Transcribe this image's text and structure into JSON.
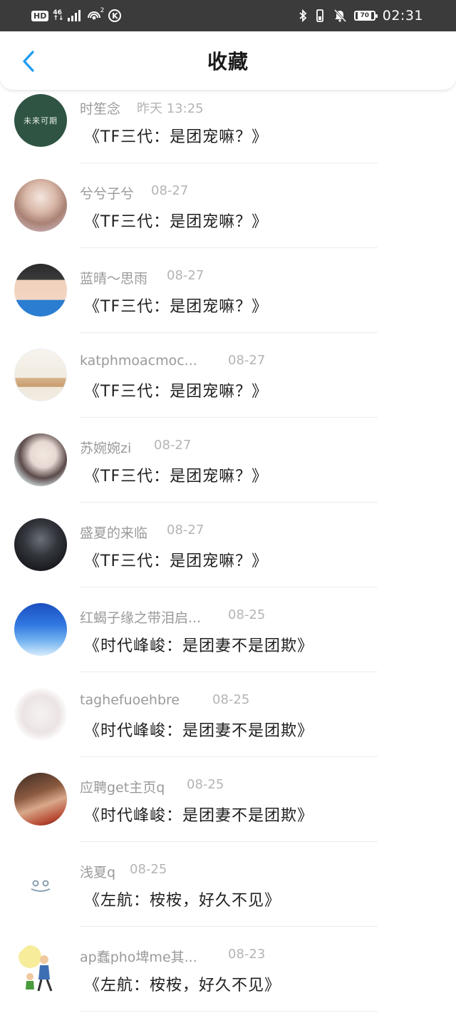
{
  "status_bar": {
    "hd": "HD",
    "network_top": "46",
    "network_bottom": "↑↓",
    "hotspot_sup": "2",
    "k_badge": "K",
    "battery": "70",
    "time": "02:31"
  },
  "header": {
    "title": "收藏"
  },
  "items": [
    {
      "name": "时笙念",
      "time": "昨天 13:25",
      "title": "《TF三代：是团宠嘛？》",
      "avatar_text": "未来可期"
    },
    {
      "name": "兮兮子兮",
      "time": "08-27",
      "title": "《TF三代：是团宠嘛？》"
    },
    {
      "name": "蓝晴～思雨",
      "time": "08-27",
      "title": "《TF三代：是团宠嘛？》"
    },
    {
      "name": "katphmoacmoc...",
      "time": "08-27",
      "title": "《TF三代：是团宠嘛？》"
    },
    {
      "name": "苏婉婉zi",
      "time": "08-27",
      "title": "《TF三代：是团宠嘛？》"
    },
    {
      "name": "盛夏的来临",
      "time": "08-27",
      "title": "《TF三代：是团宠嘛？》"
    },
    {
      "name": "红蝎子缘之带泪启...",
      "time": "08-25",
      "title": "《时代峰峻：是团妻不是团欺》"
    },
    {
      "name": "taghefuoehbre",
      "time": "08-25",
      "title": "《时代峰峻：是团妻不是团欺》"
    },
    {
      "name": "应聘get主页q",
      "time": "08-25",
      "title": "《时代峰峻：是团妻不是团欺》"
    },
    {
      "name": "浅夏q",
      "time": "08-25",
      "title": "《左航：桉桉，好久不见》"
    },
    {
      "name": "ap蠢pho埤me其...",
      "time": "08-23",
      "title": "《左航：桉桉，好久不见》"
    }
  ]
}
